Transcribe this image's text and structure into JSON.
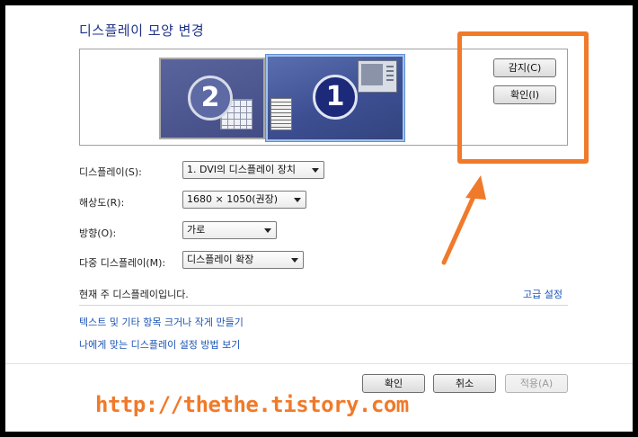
{
  "title": "디스플레이 모양 변경",
  "preview": {
    "monitor_2": "2",
    "monitor_1": "1"
  },
  "buttons": {
    "detect": "감지(C)",
    "identify": "확인(I)"
  },
  "settings": {
    "display_label": "디스플레이(S):",
    "display_value": "1. DVI의 디스플레이 장치",
    "resolution_label": "해상도(R):",
    "resolution_value": "1680 × 1050(권장)",
    "orientation_label": "방향(O):",
    "orientation_value": "가로",
    "multi_label": "다중 디스플레이(M):",
    "multi_value": "디스플레이 확장"
  },
  "status": "현재 주 디스플레이입니다.",
  "advanced_link": "고급 설정",
  "links": [
    "텍스트 및 기타 항목 크거나 작게 만들기",
    "나에게 맞는 디스플레이 설정 방법 보기"
  ],
  "footer": {
    "ok": "확인",
    "cancel": "취소",
    "apply": "적용(A)"
  },
  "watermark": "http://thethe.tistory.com",
  "colors": {
    "accent_orange": "#f07a2a",
    "title_blue": "#1e3287",
    "link_blue": "#1b54b5"
  }
}
